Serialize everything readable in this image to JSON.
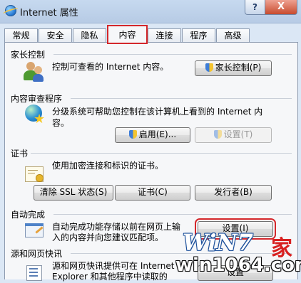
{
  "window": {
    "title": "Internet 属性",
    "help_label": "?",
    "close_label": "X"
  },
  "tabs": [
    {
      "label": "常规"
    },
    {
      "label": "安全"
    },
    {
      "label": "隐私"
    },
    {
      "label": "内容",
      "selected": true
    },
    {
      "label": "连接"
    },
    {
      "label": "程序"
    },
    {
      "label": "高级"
    }
  ],
  "sections": {
    "parental": {
      "title": "家长控制",
      "description": "控制可查看的 Internet 内容。",
      "button": "家长控制(P)",
      "icon": "users-icon"
    },
    "advisor": {
      "title": "内容审查程序",
      "description_line1": "分级系统可帮助您控制在该计算机上看到的 Internet 内",
      "description_line2": "容。",
      "enable_button": "启用(E)...",
      "settings_button": "设置(T)",
      "icon": "globe-star-icon"
    },
    "certificates": {
      "title": "证书",
      "description": "使用加密连接和标识的证书。",
      "clear_ssl_button": "清除 SSL 状态(S)",
      "certificates_button": "证书(C)",
      "publishers_button": "发行者(B)",
      "icon": "certificate-icon"
    },
    "autocomplete": {
      "title": "自动完成",
      "description_line1": "自动完成功能存储以前在网页上输",
      "description_line2": "入的内容并向您建议匹配项。",
      "settings_button": "设置(I)",
      "icon": "autocomplete-icon"
    },
    "feeds": {
      "title": "源和网页快讯",
      "description_line1": "源和网页快讯提供可在 Internet",
      "description_line2": "Explorer 和其他程序中读取的",
      "settings_button": "设置",
      "icon": "feed-icon"
    }
  },
  "watermark": {
    "top": "WiN7",
    "top_mark": "家",
    "url": "win1064.com"
  },
  "colors": {
    "highlight": "#d4272b",
    "window_bg": "#dbe7f5",
    "panel_bg": "#f6f7f9"
  }
}
